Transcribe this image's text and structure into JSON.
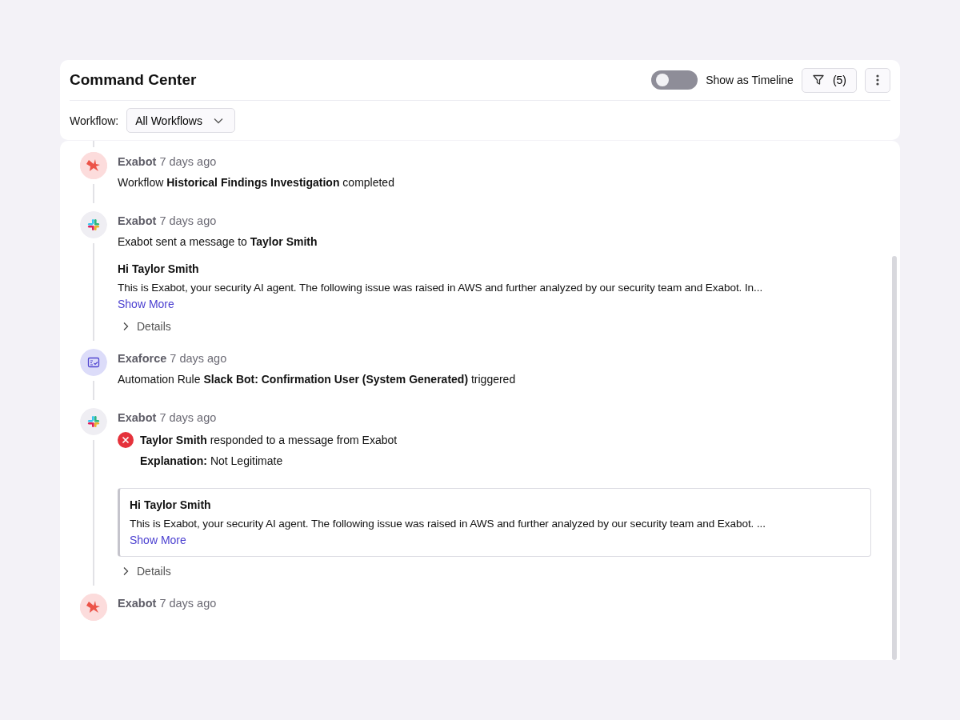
{
  "header": {
    "title": "Command Center",
    "timeline_toggle": {
      "label": "Show as Timeline",
      "on": false
    },
    "filter_button": {
      "count": "(5)"
    }
  },
  "workflow_filter": {
    "label": "Workflow:",
    "value": "All Workflows"
  },
  "events": [
    {
      "kind": "workflow",
      "actor": "Exabot",
      "time": "7 days ago",
      "content": [
        {
          "kind": "text",
          "text": "Workflow **Historical Findings Investigation** completed"
        }
      ]
    },
    {
      "kind": "message",
      "actor": "Exabot",
      "time": "7 days ago",
      "content": [
        {
          "kind": "text",
          "text": "Exabot sent a message to **Taylor Smith**"
        },
        {
          "kind": "message",
          "title": "Hi Taylor Smith",
          "body": "This is Exabot, your security AI agent. The following issue was raised in AWS and further analyzed by our security team and Exabot. In...",
          "link": "Show More"
        },
        {
          "kind": "details",
          "label": "Details",
          "expanded": false
        }
      ]
    },
    {
      "kind": "automation",
      "actor": "Exaforce",
      "time": "7 days ago",
      "content": [
        {
          "kind": "text",
          "text": "Automation Rule **Slack Bot: Confirmation User (System Generated)** triggered"
        }
      ]
    },
    {
      "kind": "message",
      "actor": "Exabot",
      "time": "7 days ago",
      "content": [
        {
          "kind": "response",
          "text": "**Taylor Smith** responded to a message from Exabot",
          "explanation": "**Explanation:** Not Legitimate"
        },
        {
          "kind": "boxed_message",
          "title": "Hi Taylor Smith",
          "body": "This is Exabot, your security AI agent. The following issue was raised in AWS and further analyzed by our security team and Exabot. ...",
          "link": "Show More"
        },
        {
          "kind": "details",
          "label": "Details",
          "expanded": false
        }
      ]
    },
    {
      "kind": "workflow",
      "actor": "Exabot",
      "time": "7 days ago"
    }
  ]
}
